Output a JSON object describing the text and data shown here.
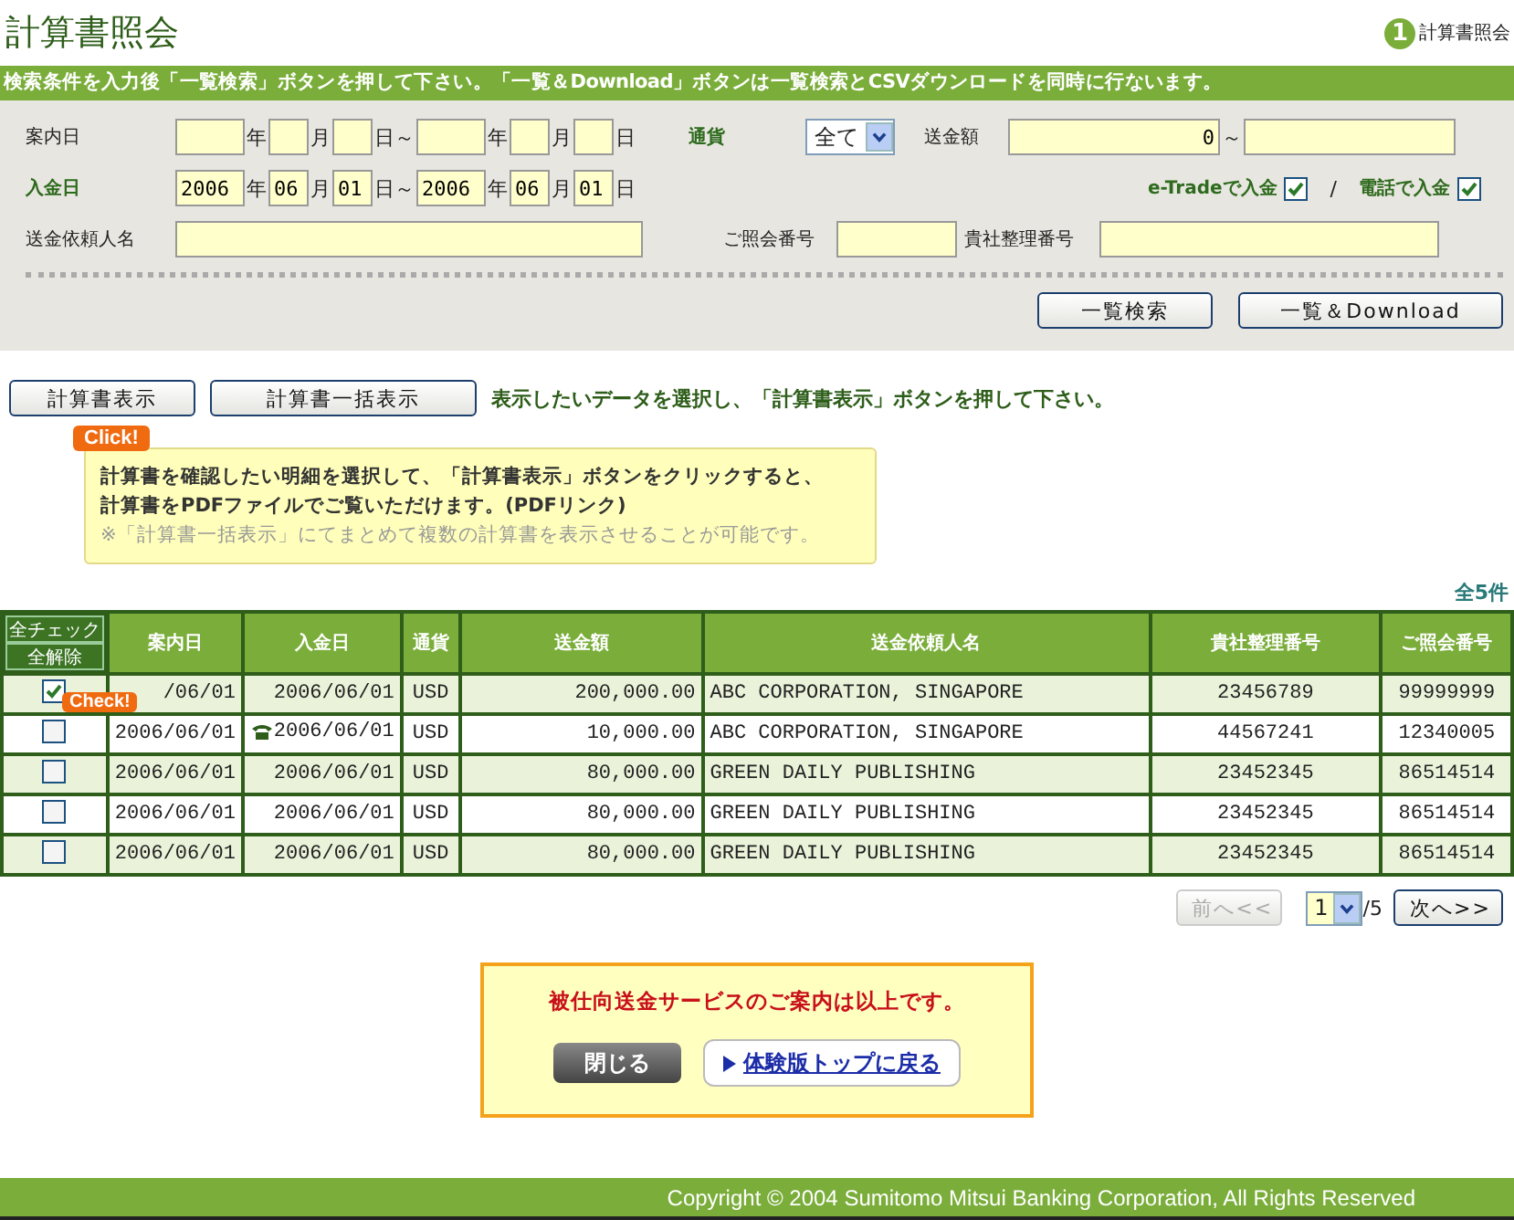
{
  "title": "計算書照会",
  "step": {
    "number": "1",
    "label": "計算書照会"
  },
  "banner": "検索条件を入力後「一覧検索」ボタンを押して下さい。「一覧＆Download」ボタンは一覧検索とCSVダウンロードを同時に行ないます。",
  "form": {
    "notice_date": {
      "label": "案内日",
      "highlight": false,
      "parts": [
        {
          "kind": "year_input"
        },
        {
          "kind": "unit",
          "text": "年"
        },
        {
          "kind": "short_input"
        },
        {
          "kind": "unit",
          "text": "月"
        },
        {
          "kind": "short_input"
        },
        {
          "kind": "unit",
          "text": "日～"
        },
        {
          "kind": "year_input"
        },
        {
          "kind": "unit",
          "text": "年"
        },
        {
          "kind": "short_input"
        },
        {
          "kind": "unit",
          "text": "月"
        },
        {
          "kind": "short_input"
        },
        {
          "kind": "unit",
          "text": "日"
        }
      ]
    },
    "currency": {
      "label": "通貨",
      "highlight": true,
      "value": "全て"
    },
    "amount": {
      "label": "送金額",
      "from": "0",
      "separator": "～"
    },
    "deposit_date": {
      "label": "入金日",
      "highlight": true,
      "parts": [
        {
          "kind": "year_input",
          "value": "2006"
        },
        {
          "kind": "unit",
          "text": "年"
        },
        {
          "kind": "short_input",
          "value": "06"
        },
        {
          "kind": "unit",
          "text": "月"
        },
        {
          "kind": "short_input",
          "value": "01"
        },
        {
          "kind": "unit",
          "text": "日～"
        },
        {
          "kind": "year_input",
          "value": "2006"
        },
        {
          "kind": "unit",
          "text": "年"
        },
        {
          "kind": "short_input",
          "value": "06"
        },
        {
          "kind": "unit",
          "text": "月"
        },
        {
          "kind": "short_input",
          "value": "01"
        },
        {
          "kind": "unit",
          "text": "日"
        }
      ]
    },
    "channels": [
      {
        "label": "e-Tradeで入金",
        "checked": true
      },
      {
        "label": "電話で入金",
        "checked": true
      }
    ],
    "channel_separator": "/",
    "remitter": {
      "label": "送金依頼人名"
    },
    "reference_no": {
      "label": "ご照会番号"
    },
    "company_no": {
      "label": "貴社整理番号"
    },
    "buttons": [
      "一覧検索",
      "一覧＆Download"
    ]
  },
  "actions": {
    "buttons": [
      "計算書表示",
      "計算書一括表示"
    ],
    "hint": "表示したいデータを選択し、「計算書表示」ボタンを押して下さい。"
  },
  "tooltip": {
    "badge": "Click!",
    "lines": [
      "計算書を確認したい明細を選択して、「計算書表示」ボタンをクリックすると、",
      "計算書をPDFファイルでご覧いただけます。(PDFリンク)"
    ],
    "note": "※「計算書一括表示」にてまとめて複数の計算書を表示させることが可能です。"
  },
  "table": {
    "total": "全5件",
    "check_all": "全チェック",
    "clear_all": "全解除",
    "check_badge": "Check!",
    "columns": [
      "案内日",
      "入金日",
      "通貨",
      "送金額",
      "送金依頼人名",
      "貴社整理番号",
      "ご照会番号"
    ],
    "rows": [
      {
        "checked": true,
        "phone": false,
        "cells": [
          "/06/01",
          "2006/06/01",
          "USD",
          "200,000.00",
          "ABC CORPORATION, SINGAPORE",
          "23456789",
          "99999999"
        ]
      },
      {
        "checked": false,
        "phone": true,
        "cells": [
          "2006/06/01",
          "2006/06/01",
          "USD",
          "10,000.00",
          "ABC CORPORATION, SINGAPORE",
          "44567241",
          "12340005"
        ]
      },
      {
        "checked": false,
        "phone": false,
        "cells": [
          "2006/06/01",
          "2006/06/01",
          "USD",
          "80,000.00",
          "GREEN DAILY PUBLISHING",
          "23452345",
          "86514514"
        ]
      },
      {
        "checked": false,
        "phone": false,
        "cells": [
          "2006/06/01",
          "2006/06/01",
          "USD",
          "80,000.00",
          "GREEN DAILY PUBLISHING",
          "23452345",
          "86514514"
        ]
      },
      {
        "checked": false,
        "phone": false,
        "cells": [
          "2006/06/01",
          "2006/06/01",
          "USD",
          "80,000.00",
          "GREEN DAILY PUBLISHING",
          "23452345",
          "86514514"
        ]
      }
    ]
  },
  "pager": {
    "prev": {
      "label": "前へ<<",
      "disabled": true
    },
    "page": "1",
    "of": "/5",
    "next": {
      "label": "次へ>>",
      "disabled": false
    }
  },
  "notice": {
    "message": "被仕向送金サービスのご案内は以上です。",
    "close": "閉じる",
    "link": "体験版トップに戻る"
  },
  "footer": "Copyright © 2004 Sumitomo Mitsui Banking Corporation, All Rights Reserved"
}
